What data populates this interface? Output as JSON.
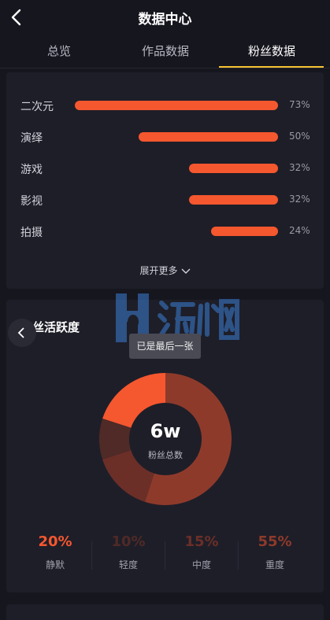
{
  "header": {
    "title": "数据中心"
  },
  "tabs": [
    {
      "label": "总览"
    },
    {
      "label": "作品数据"
    },
    {
      "label": "粉丝数据"
    }
  ],
  "interests": [
    {
      "label": "二次元",
      "value": 73,
      "pct": "73%"
    },
    {
      "label": "演绎",
      "value": 50,
      "pct": "50%"
    },
    {
      "label": "游戏",
      "value": 32,
      "pct": "32%"
    },
    {
      "label": "影视",
      "value": 32,
      "pct": "32%"
    },
    {
      "label": "拍摄",
      "value": 24,
      "pct": "24%"
    }
  ],
  "expand_label": "展开更多",
  "activity": {
    "title": "粉丝活跃度",
    "toast": "已是最后一张",
    "total": "6w",
    "total_label": "粉丝总数",
    "segments": [
      {
        "label": "静默",
        "value": 20,
        "pct": "20%",
        "color": "#f5572f"
      },
      {
        "label": "轻度",
        "value": 10,
        "pct": "10%",
        "color": "#4f2a27"
      },
      {
        "label": "中度",
        "value": 15,
        "pct": "15%",
        "color": "#6b2f28"
      },
      {
        "label": "重度",
        "value": 55,
        "pct": "55%",
        "color": "#8e3a2b"
      }
    ]
  },
  "colors": {
    "accent": "#f5572f",
    "tab_indicator": "#f7c331",
    "background": "#16161f",
    "card": "#1e1e28"
  }
}
